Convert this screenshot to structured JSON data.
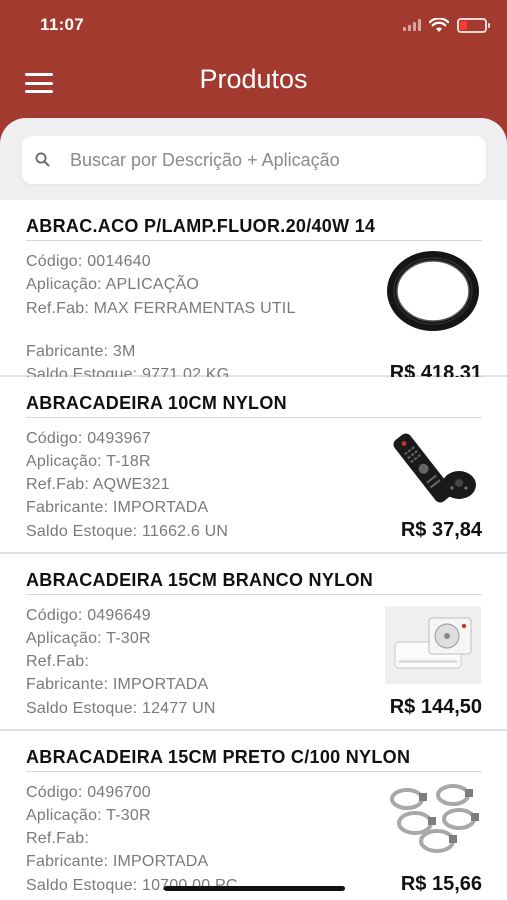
{
  "status_bar": {
    "time": "11:07",
    "battery_color": "#ff3b30"
  },
  "header": {
    "title": "Produtos",
    "background": "#a23a30",
    "menu_icon": "hamburger-menu-icon"
  },
  "search": {
    "placeholder": "Buscar por Descrição + Aplicação",
    "value": "",
    "icon": "search-icon"
  },
  "products": [
    {
      "title": "ABRAC.ACO P/LAMP.FLUOR.20/40W 14",
      "codigo": "Código: 0014640",
      "aplicacao": "Aplicação: APLICAÇÃO",
      "ref_fab": "Ref.Fab: MAX FERRAMENTAS UTIL",
      "fabricante": "Fabricante: 3M",
      "saldo": "Saldo Estoque: 9771.02  KG",
      "price": "R$ 418,31",
      "image": "tire-image"
    },
    {
      "title": "ABRACADEIRA 10CM NYLON",
      "codigo": "Código: 0493967",
      "aplicacao": "Aplicação: T-18R",
      "ref_fab": "Ref.Fab: AQWE321",
      "fabricante": "Fabricante: IMPORTADA",
      "saldo": "Saldo Estoque: 11662.6  UN",
      "price": "R$ 37,84",
      "image": "remote-control-image"
    },
    {
      "title": "ABRACADEIRA 15CM BRANCO NYLON",
      "codigo": "Código: 0496649",
      "aplicacao": "Aplicação: T-30R",
      "ref_fab": "Ref.Fab:",
      "fabricante": "Fabricante: IMPORTADA",
      "saldo": "Saldo Estoque: 12477  UN",
      "price": "R$ 144,50",
      "image": "air-conditioner-image"
    },
    {
      "title": "ABRACADEIRA 15CM PRETO C/100 NYLON",
      "codigo": "Código: 0496700",
      "aplicacao": "Aplicação: T-30R",
      "ref_fab": "Ref.Fab:",
      "fabricante": "Fabricante: IMPORTADA",
      "saldo": "Saldo Estoque: 10700.00  PC",
      "price": "R$ 15,66",
      "image": "hose-clamps-image"
    }
  ]
}
